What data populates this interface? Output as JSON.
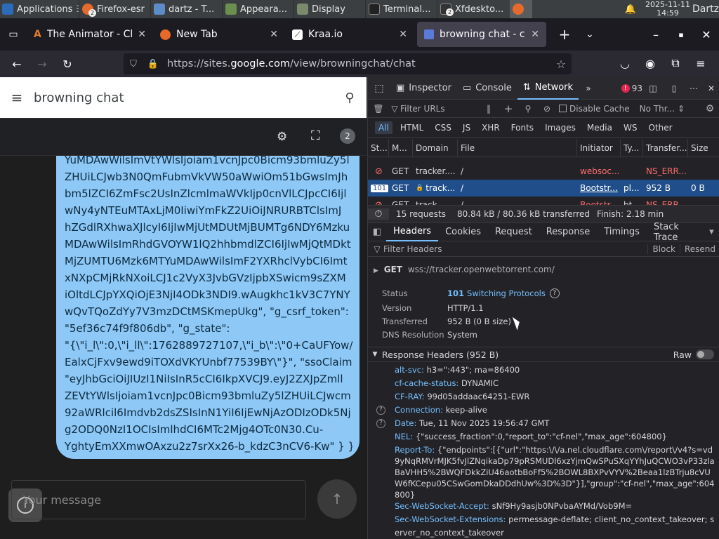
{
  "taskbar": {
    "apps_label": "Applications",
    "tasks": [
      {
        "label": "Firefox-esr",
        "badge": "2"
      },
      {
        "label": "dartz - T..."
      },
      {
        "label": "Appeara..."
      },
      {
        "label": "Display"
      },
      {
        "label": "Terminal..."
      },
      {
        "label": "Xfdeskto...",
        "badge": "2"
      }
    ],
    "date": "2025-11-11",
    "time": "14:59",
    "user": "Dartz"
  },
  "tabs": [
    {
      "title": "The Animator - Chr",
      "icon": "animator-icon"
    },
    {
      "title": "New Tab",
      "icon": "firefox-icon"
    },
    {
      "title": "Kraa.io",
      "icon": "kraa-icon"
    },
    {
      "title": "browning chat - cha",
      "icon": "google-sites-icon",
      "active": true
    }
  ],
  "nav": {
    "url_prefix": "https://sites.",
    "url_host": "google.com",
    "url_path": "/view/browningchat/chat"
  },
  "page": {
    "site_title": "browning chat",
    "tools_badge": "2",
    "message_lines": [
      "YuMDAwWilsImVtYWlsIjoiam1vcnJpc0Bicm93bmluZy5l",
      "ZHUiLCJwb3N0QmFubmVkVW50aWwiOm51bGwsImJh",
      "bm5lZCI6ZmFsc2UsInZlcmlmaWVkIjp0cnVlLCJpcCI6Ijl",
      "wNy4yNTEuMTAxLjM0IiwiYmFkZ2UiOiJNRURBTClsImJ",
      "hZGdlRXhwaXJlcyI6IjIwMjUtMDUtMjBUMTg6NDY6Mzku",
      "MDAwWilsImRhdGVOYW1lQ2hhbmdlZCI6IjIwMjQtMDkt",
      "MjZUMTU6Mzk6MTYuMDAwWilsImF2YXRhclVybCI6Imt",
      "xNXpCMjRkNXoiLCJ1c2VyX3JvbGVzIjpbXSwicm9sZXM",
      "iOltdLCJpYXQiOjE3NjI4ODk3NDI9.wAugkhc1kV3C7YNY",
      "wQvTQoZdYy7V3mzDCtMSKmepUkg\", \"g_csrf_token\":",
      "\"5ef36c74f9f806db\", \"g_state\":",
      "\"{\\\"i_l\\\":0,\\\"i_ll\\\":1762889727107,\\\"i_b\\\":\\\"0+CaUFYow/",
      "EalxCjFxv9ewd9iTOXdVKYUnbf77539BY\\\"}\", \"ssoClaim\":",
      "\"eyJhbGciOiJIUzI1NiIsInR5cCI6IkpXVCJ9.eyJ2ZXJpZmll",
      "ZEVtYWlsIjoiam1vcnJpc0Bicm93bmluZy5lZHUiLCJwcm",
      "92aWRlcil6Imdvb2dsZSIsInN1YiI6IjEwNjAzODIzODk5Nj",
      "g2ODQ0NzI1OCIsImlhdCI6MTc2Mjg4OTc0N30.Cu-",
      "YghtyEmXXmwOAxzu2z7srXx26-b_kdzC3nCV6-Kw\" } }"
    ],
    "composer_placeholder": "Your message"
  },
  "devtools": {
    "tabs": [
      "Inspector",
      "Console",
      "Network"
    ],
    "error_count": "93",
    "filter_placeholder": "Filter URLs",
    "disable_cache": "Disable Cache",
    "throttle": "No Thr...",
    "types": [
      "All",
      "HTML",
      "CSS",
      "JS",
      "XHR",
      "Fonts",
      "Images",
      "Media",
      "WS",
      "Other"
    ],
    "columns": [
      "St...",
      "M...",
      "Domain",
      "File",
      "Initiator",
      "Ty...",
      "Transfer...",
      "Size"
    ],
    "rows": [
      {
        "status": "",
        "method": "GET",
        "domain": "tracker....",
        "file": "/",
        "initiator": "websoc...",
        "type": "",
        "transfer": "NS_ERR...",
        "size": ""
      },
      {
        "status": "101",
        "method": "GET",
        "domain": "track...",
        "file": "/",
        "initiator": "Bootstr...",
        "type": "pl...",
        "transfer": "952 B",
        "size": "0 B"
      },
      {
        "status": "",
        "method": "GET",
        "domain": "track...",
        "file": "/",
        "initiator": "Bootstr...",
        "type": "bt...",
        "transfer": "NS_ERR...",
        "size": ""
      }
    ],
    "summary": {
      "requests": "15 requests",
      "transferred": "80.84 kB / 80.36 kB transferred",
      "finish": "Finish: 2.18 min"
    },
    "detail_tabs": [
      "Headers",
      "Cookies",
      "Request",
      "Response",
      "Timings",
      "Stack Trace"
    ],
    "header_filter": "Filter Headers",
    "block": "Block",
    "resend": "Resend",
    "request_method": "GET",
    "request_url": "wss://tracker.openwebtorrent.com/",
    "status": {
      "label": "Status",
      "code": "101",
      "text": "Switching Protocols"
    },
    "version": {
      "label": "Version",
      "value": "HTTP/1.1"
    },
    "transferred": {
      "label": "Transferred",
      "value": "952 B (0 B size)"
    },
    "dns": {
      "label": "DNS Resolution",
      "value": "System"
    },
    "response_headers_title": "Response Headers (952 B)",
    "raw": "Raw",
    "headers": [
      {
        "k": "alt-svc:",
        "v": "h3=\":443\"; ma=86400"
      },
      {
        "k": "cf-cache-status:",
        "v": "DYNAMIC"
      },
      {
        "k": "CF-RAY:",
        "v": "99d05addaac64251-EWR"
      },
      {
        "k": "Connection:",
        "v": "keep-alive",
        "help": true
      },
      {
        "k": "Date:",
        "v": "Tue, 11 Nov 2025 19:56:47 GMT",
        "help": true
      },
      {
        "k": "NEL:",
        "v": "{\"success_fraction\":0,\"report_to\":\"cf-nel\",\"max_age\":604800}"
      },
      {
        "k": "Report-To:",
        "v": "{\"endpoints\":[{\"url\":\"https:\\/\\/a.nel.cloudflare.com\\/report\\/v4?s=vd"
      },
      {
        "k": "",
        "v": "9yNqRMVrMJK5fvJlZNqikaDp79pRSMUDl6xzYjmQwSPuSXqYYhJuQCWO3vP33zla"
      },
      {
        "k": "",
        "v": "BaVHH5%2BWQFDkkZiU46aotbBoFf5%2BOWL8BXPvVYV%2Beaa1lzBTrju8cVU"
      },
      {
        "k": "",
        "v": "W6fKCepu05CSwGomDkaDDdhUw%3D%3D\"}],\"group\":\"cf-nel\",\"max_age\":604"
      },
      {
        "k": "",
        "v": "800}"
      },
      {
        "k": "Sec-WebSocket-Accept:",
        "v": "sNf9Hy9asjb0NPvbaAYMd/Vob9M="
      },
      {
        "k": "Sec-WebSocket-Extensions:",
        "v": "permessage-deflate; client_no_context_takeover; s"
      },
      {
        "k": "",
        "v": "erver_no_context_takeover"
      }
    ]
  }
}
